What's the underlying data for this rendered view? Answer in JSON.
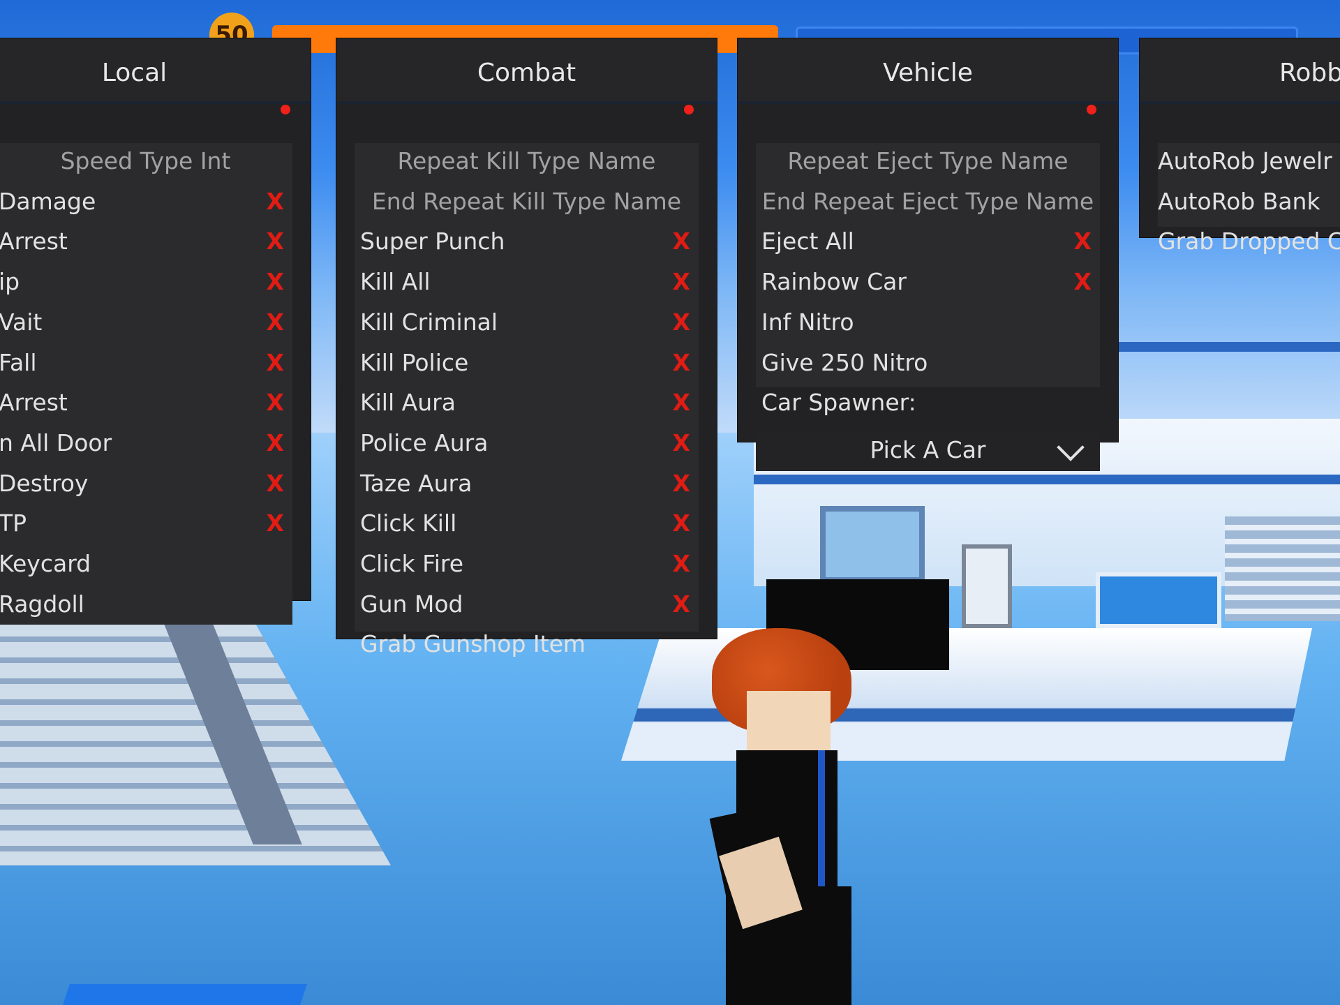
{
  "hud": {
    "level": "50"
  },
  "panels": {
    "local": {
      "title": "Local",
      "items": [
        {
          "label": "Speed Type Int",
          "toggle": ""
        },
        {
          "label": "Damage",
          "toggle": "X"
        },
        {
          "label": "Arrest",
          "toggle": "X"
        },
        {
          "label": "ip",
          "toggle": "X"
        },
        {
          "label": "Vait",
          "toggle": "X"
        },
        {
          "label": "Fall",
          "toggle": "X"
        },
        {
          "label": "Arrest",
          "toggle": "X"
        },
        {
          "label": "n All Door",
          "toggle": "X"
        },
        {
          "label": "Destroy",
          "toggle": "X"
        },
        {
          "label": "TP",
          "toggle": "X"
        },
        {
          "label": "Keycard",
          "toggle": ""
        },
        {
          "label": "Ragdoll",
          "toggle": ""
        }
      ]
    },
    "combat": {
      "title": "Combat",
      "items": [
        {
          "label": "Repeat Kill Type Name",
          "toggle": ""
        },
        {
          "label": "End Repeat Kill Type Name",
          "toggle": ""
        },
        {
          "label": "Super Punch",
          "toggle": "X"
        },
        {
          "label": "Kill All",
          "toggle": "X"
        },
        {
          "label": "Kill Criminal",
          "toggle": "X"
        },
        {
          "label": "Kill Police",
          "toggle": "X"
        },
        {
          "label": "Kill Aura",
          "toggle": "X"
        },
        {
          "label": "Police Aura",
          "toggle": "X"
        },
        {
          "label": "Taze Aura",
          "toggle": "X"
        },
        {
          "label": "Click Kill",
          "toggle": "X"
        },
        {
          "label": "Click Fire",
          "toggle": "X"
        },
        {
          "label": "Gun Mod",
          "toggle": "X"
        },
        {
          "label": "Grab Gunshop Item",
          "toggle": ""
        }
      ]
    },
    "vehicle": {
      "title": "Vehicle",
      "items": [
        {
          "label": "Repeat Eject Type Name",
          "toggle": ""
        },
        {
          "label": "End Repeat Eject Type Name",
          "toggle": ""
        },
        {
          "label": "Eject All",
          "toggle": "X"
        },
        {
          "label": "Rainbow Car",
          "toggle": "X"
        },
        {
          "label": "Inf Nitro",
          "toggle": ""
        },
        {
          "label": "Give 250 Nitro",
          "toggle": ""
        },
        {
          "label": "Car Spawner:",
          "toggle": ""
        }
      ],
      "dropdown_value": "Pick A Car"
    },
    "robbery": {
      "title": "Robb",
      "items": [
        {
          "label": "AutoRob Jewelr",
          "toggle": ""
        },
        {
          "label": "AutoRob Bank",
          "toggle": ""
        },
        {
          "label": "Grab Dropped C",
          "toggle": ""
        }
      ]
    }
  },
  "colors": {
    "toggle_off": "#e01c14",
    "panel_bg": "#222224",
    "accent_dot": "#f0201a"
  }
}
